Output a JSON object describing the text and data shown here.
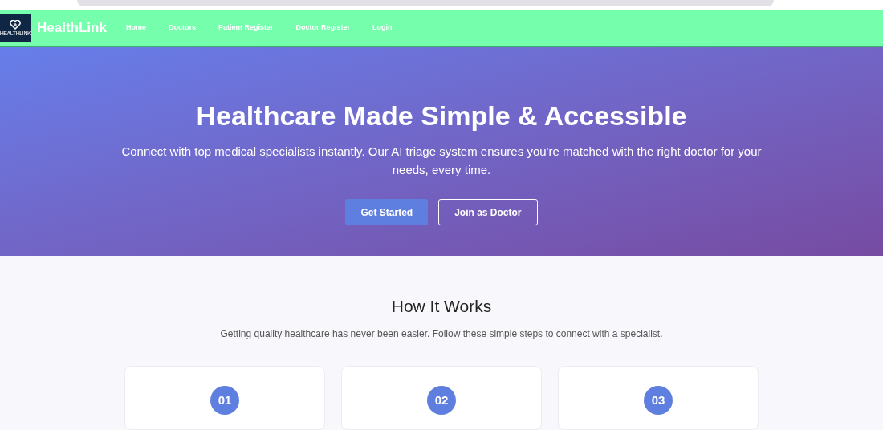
{
  "nav": {
    "logo_text": "HEALTHLINK",
    "brand": "HealthLink",
    "links": [
      {
        "label": "Home"
      },
      {
        "label": "Doctors"
      },
      {
        "label": "Patient Register"
      },
      {
        "label": "Doctor Register"
      },
      {
        "label": "Login"
      }
    ]
  },
  "hero": {
    "title": "Healthcare Made Simple & Accessible",
    "subtitle": "Connect with top medical specialists instantly. Our AI triage system ensures you're matched with the right doctor for your needs, every time.",
    "buttons": [
      {
        "label": "Get Started",
        "kind": "primary"
      },
      {
        "label": "Join as Doctor",
        "kind": "outline"
      }
    ]
  },
  "how_it_works": {
    "title": "How It Works",
    "subtitle": "Getting quality healthcare has never been easier. Follow these simple steps to connect with a specialist.",
    "steps": [
      {
        "number": "01"
      },
      {
        "number": "02"
      },
      {
        "number": "03"
      }
    ]
  }
}
